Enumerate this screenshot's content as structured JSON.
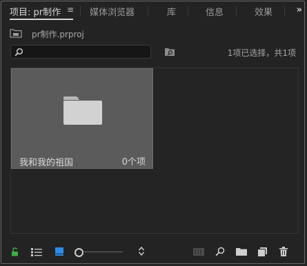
{
  "tabs": [
    {
      "label": "项目: pr制作",
      "active": true
    },
    {
      "label": "媒体浏览器",
      "active": false
    },
    {
      "label": "库",
      "active": false
    },
    {
      "label": "信息",
      "active": false
    },
    {
      "label": "效果",
      "active": false
    }
  ],
  "tab_menu_glyph": "≡",
  "overflow_glyph": "»",
  "project": {
    "file_name": "pr制作.prproj"
  },
  "search": {
    "value": "",
    "placeholder": ""
  },
  "selection_status": "1项已选择，共1项",
  "bin": {
    "name": "我和我的祖国",
    "item_count": "0个项"
  },
  "toolbar": {
    "icons": [
      "lock-open-icon",
      "list-view-icon",
      "icon-view-icon",
      "zoom-slider",
      "sort-icon",
      "automate-to-sequence-icon",
      "find-icon",
      "new-bin-icon",
      "new-item-icon",
      "clear-trash-icon"
    ],
    "zoom_level": 0.0
  },
  "colors": {
    "panel_bg": "#232323",
    "tile_bg": "#5b5b5b",
    "lock_green": "#3fae49",
    "icon_view_blue": "#2d8ceb",
    "text": "#bdbdbd"
  }
}
